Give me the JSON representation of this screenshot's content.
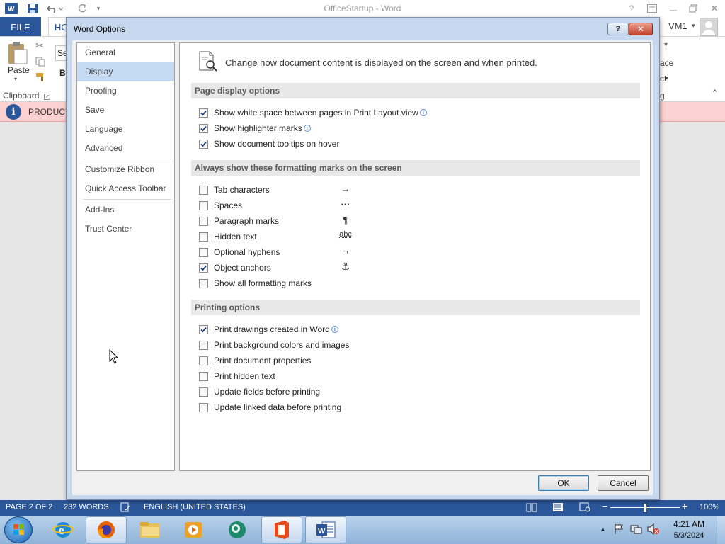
{
  "word": {
    "title": "OfficeStartup - Word",
    "file_tab": "FILE",
    "home_tab": "HO",
    "paste_label": "Paste",
    "clipboard_label": "Clipboard",
    "font_box": "Se",
    "bold_label": "B",
    "replace_label": "ace",
    "select_label": "ct",
    "editing_label": "g",
    "message_label": "PRODUCT",
    "user": "VM1",
    "help": "?"
  },
  "dialog": {
    "title": "Word Options",
    "help_glyph": "?",
    "close_glyph": "✕",
    "header": "Change how document content is displayed on the screen and when printed.",
    "nav": [
      {
        "label": "General"
      },
      {
        "label": "Display",
        "selected": true
      },
      {
        "label": "Proofing"
      },
      {
        "label": "Save"
      },
      {
        "label": "Language"
      },
      {
        "label": "Advanced"
      },
      {
        "label": "Customize Ribbon"
      },
      {
        "label": "Quick Access Toolbar"
      },
      {
        "label": "Add-Ins"
      },
      {
        "label": "Trust Center"
      }
    ],
    "page_display": {
      "heading": "Page display options",
      "options": [
        {
          "label": "Show white space between pages in Print Layout view",
          "checked": true,
          "info": true
        },
        {
          "label": "Show highlighter marks",
          "checked": true,
          "info": true
        },
        {
          "label": "Show document tooltips on hover",
          "checked": true,
          "info": false
        }
      ]
    },
    "formatting_marks": {
      "heading": "Always show these formatting marks on the screen",
      "options": [
        {
          "label": "Tab characters",
          "checked": false,
          "symbol": "→"
        },
        {
          "label": "Spaces",
          "checked": false,
          "symbol": "···"
        },
        {
          "label": "Paragraph marks",
          "checked": false,
          "symbol": "¶"
        },
        {
          "label": "Hidden text",
          "checked": false,
          "symbol": "abc"
        },
        {
          "label": "Optional hyphens",
          "checked": false,
          "symbol": "¬"
        },
        {
          "label": "Object anchors",
          "checked": true,
          "symbol": "⚓"
        },
        {
          "label": "Show all formatting marks",
          "checked": false,
          "symbol": ""
        }
      ]
    },
    "printing": {
      "heading": "Printing options",
      "options": [
        {
          "label": "Print drawings created in Word",
          "checked": true,
          "info": true
        },
        {
          "label": "Print background colors and images",
          "checked": false,
          "info": false
        },
        {
          "label": "Print document properties",
          "checked": false,
          "info": false
        },
        {
          "label": "Print hidden text",
          "checked": false,
          "info": false
        },
        {
          "label": "Update fields before printing",
          "checked": false,
          "info": false
        },
        {
          "label": "Update linked data before printing",
          "checked": false,
          "info": false
        }
      ]
    },
    "ok_label": "OK",
    "cancel_label": "Cancel"
  },
  "status": {
    "page": "PAGE 2 OF 2",
    "words": "232 WORDS",
    "language": "ENGLISH (UNITED STATES)",
    "zoom": "100%",
    "zoom_level": 1.0
  },
  "taskbar": {
    "time": "4:21 AM",
    "date": "5/3/2024",
    "apps": [
      "start-orb-icon",
      "internet-explorer-icon",
      "firefox-icon",
      "file-explorer-icon",
      "media-player-icon",
      "app-sphere-icon",
      "office-icon",
      "word-icon"
    ]
  },
  "colors": {
    "accent": "#2b579a",
    "dialog_frame": "#c7d8ee",
    "nav_selected": "#c5daf3",
    "message_bar": "#fbd1d1"
  }
}
